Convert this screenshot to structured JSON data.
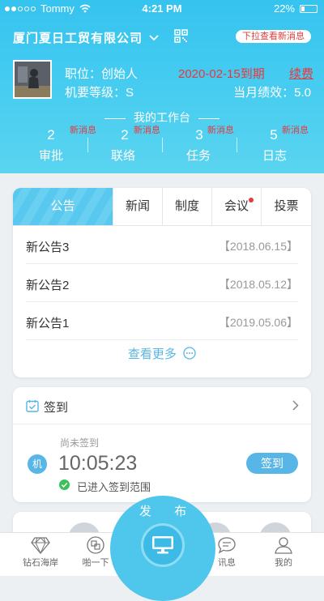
{
  "status_bar": {
    "carrier": "Tommy",
    "time": "4:21 PM",
    "battery": "22%"
  },
  "header": {
    "company": "厦门夏日工贸有限公司",
    "pull_hint": "下拉查看新消息",
    "role": "职位：创始人",
    "secret_level": "机要等级：S",
    "expiry": "2020-02-15到期",
    "renew": "续费",
    "performance": "当月绩效：5.0",
    "workbench_title": "我的工作台"
  },
  "stats": [
    {
      "count": "2",
      "badge": "新消息",
      "label": "审批"
    },
    {
      "count": "2",
      "badge": "新消息",
      "label": "联络"
    },
    {
      "count": "3",
      "badge": "新消息",
      "label": "任务"
    },
    {
      "count": "5",
      "badge": "新消息",
      "label": "日志"
    }
  ],
  "notice_card": {
    "tabs": [
      "公告",
      "新闻",
      "制度",
      "会议",
      "投票"
    ],
    "items": [
      {
        "title": "新公告3",
        "date": "【2018.06.15】"
      },
      {
        "title": "新公告2",
        "date": "【2018.05.12】"
      },
      {
        "title": "新公告1",
        "date": "【2019.05.06】"
      }
    ],
    "more": "查看更多"
  },
  "signin_card": {
    "title": "签到",
    "status": "尚未签到",
    "badge": "机",
    "time": "10:05:23",
    "range_text": "已进入签到范围",
    "button": "签到"
  },
  "publish_label": "发 布",
  "tabbar": [
    {
      "label": "钻石海岸",
      "icon": "diamond-icon"
    },
    {
      "label": "啪一下",
      "icon": "swap-icon"
    },
    {
      "label": "发布",
      "icon": "monitor-icon"
    },
    {
      "label": "讯息",
      "icon": "chat-icon"
    },
    {
      "label": "我的",
      "icon": "user-icon"
    }
  ],
  "colors": {
    "brand": "#35c3ef",
    "alert": "#e8383d",
    "accent": "#58b6e6",
    "success": "#3cc05a"
  }
}
